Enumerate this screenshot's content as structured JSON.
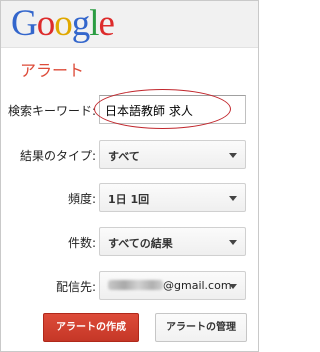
{
  "header": {
    "logo_letters": [
      {
        "char": "G",
        "color": "#3366cc"
      },
      {
        "char": "o",
        "color": "#dd2b2b"
      },
      {
        "char": "o",
        "color": "#e0a800"
      },
      {
        "char": "g",
        "color": "#3366cc"
      },
      {
        "char": "l",
        "color": "#2a9c41"
      },
      {
        "char": "e",
        "color": "#dd2b2b"
      }
    ]
  },
  "page_title": "アラート",
  "form": {
    "keyword_label": "検索キーワード:",
    "keyword_value": "日本語教師  求人",
    "result_type_label": "結果のタイプ:",
    "result_type_value": "すべて",
    "frequency_label": "頻度:",
    "frequency_value": "1日 1回",
    "count_label": "件数:",
    "count_value": "すべての結果",
    "deliver_label": "配信先:",
    "deliver_domain": "@gmail.com"
  },
  "buttons": {
    "create_label": "アラートの作成",
    "manage_label": "アラートの管理"
  },
  "colors": {
    "accent_red": "#dd4b39",
    "annotation_circle": "#c1272d"
  }
}
